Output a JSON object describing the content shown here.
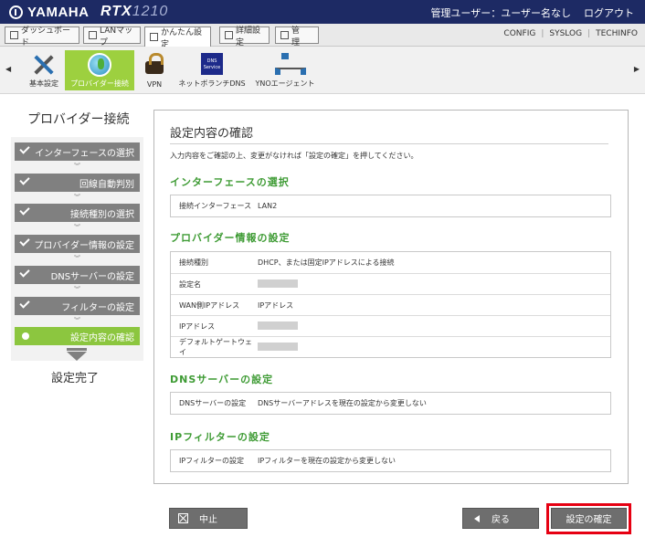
{
  "header": {
    "brand": "YAMAHA",
    "model_prefix": "RTX",
    "model_num": "1210",
    "user_label": "管理ユーザー：ユーザー名なし",
    "logout": "ログアウト"
  },
  "tabs": [
    {
      "label": "ダッシュボード"
    },
    {
      "label": "LANマップ"
    },
    {
      "label": "かんたん設定"
    },
    {
      "label": "詳細設定"
    },
    {
      "label": "管　理"
    }
  ],
  "toplinks": [
    "CONFIG",
    "SYSLOG",
    "TECHINFO"
  ],
  "ribbon": [
    {
      "label": "基本設定",
      "icon": "tools-icon"
    },
    {
      "label": "プロバイダー接続",
      "icon": "globe-icon"
    },
    {
      "label": "VPN",
      "icon": "lock-icon"
    },
    {
      "label": "ネットボランチDNS",
      "icon": "dns-icon"
    },
    {
      "label": "YNOエージェント",
      "icon": "network-icon"
    }
  ],
  "dns_icon_text": "DNS Service",
  "sidebar": {
    "title": "プロバイダー接続",
    "steps": [
      {
        "label": "インターフェースの選択"
      },
      {
        "label": "回線自動判別"
      },
      {
        "label": "接続種別の選択"
      },
      {
        "label": "プロバイダー情報の設定"
      },
      {
        "label": "DNSサーバーの設定"
      },
      {
        "label": "フィルターの設定"
      },
      {
        "label": "設定内容の確認"
      }
    ],
    "done": "設定完了"
  },
  "main": {
    "title": "設定内容の確認",
    "description": "入力内容をご確認の上、変更がなければ「設定の確定」を押してください。",
    "sections": [
      {
        "title": "インターフェースの選択",
        "rows": [
          {
            "k": "接続インターフェース",
            "v": "LAN2"
          }
        ]
      },
      {
        "title": "プロバイダー情報の設定",
        "rows": [
          {
            "k": "接続種別",
            "v": "DHCP、または固定IPアドレスによる接続"
          },
          {
            "k": "設定名",
            "v": ""
          },
          {
            "k": "WAN側IPアドレス",
            "v": "IPアドレス"
          },
          {
            "k": "IPアドレス",
            "v": ""
          },
          {
            "k": "デフォルトゲートウェイ",
            "v": ""
          }
        ]
      },
      {
        "title": "DNSサーバーの設定",
        "rows": [
          {
            "k": "DNSサーバーの設定",
            "v": "DNSサーバーアドレスを現在の設定から変更しない"
          }
        ]
      },
      {
        "title": "IPフィルターの設定",
        "rows": [
          {
            "k": "IPフィルターの設定",
            "v": "IPフィルターを現在の設定から変更しない"
          }
        ]
      }
    ]
  },
  "buttons": {
    "cancel": "中止",
    "back": "戻る",
    "confirm": "設定の確定"
  }
}
